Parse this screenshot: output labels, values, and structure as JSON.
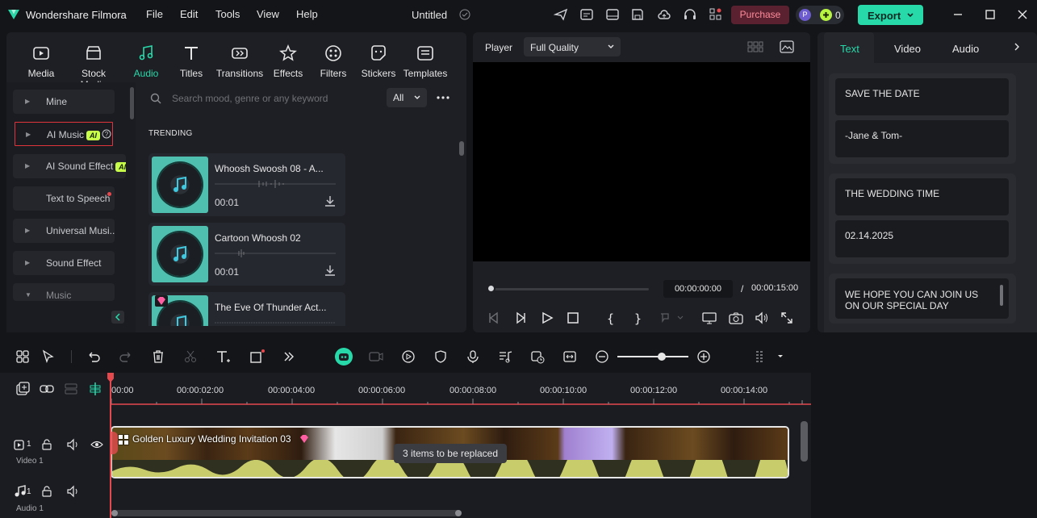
{
  "app": {
    "name": "Wondershare Filmora",
    "project_title": "Untitled"
  },
  "menu": [
    "File",
    "Edit",
    "Tools",
    "View",
    "Help"
  ],
  "topbar": {
    "purchase_label": "Purchase",
    "credits": "0",
    "avatar_letter": "P",
    "export_label": "Export"
  },
  "toolbar": [
    {
      "label": "Media",
      "icon": "media-icon"
    },
    {
      "label": "Stock Media",
      "icon": "stock-media-icon"
    },
    {
      "label": "Audio",
      "icon": "audio-icon",
      "active": true
    },
    {
      "label": "Titles",
      "icon": "titles-icon"
    },
    {
      "label": "Transitions",
      "icon": "transitions-icon"
    },
    {
      "label": "Effects",
      "icon": "effects-icon"
    },
    {
      "label": "Filters",
      "icon": "filters-icon"
    },
    {
      "label": "Stickers",
      "icon": "stickers-icon"
    },
    {
      "label": "Templates",
      "icon": "templates-icon"
    }
  ],
  "sidebar": {
    "items": [
      {
        "label": "Mine"
      },
      {
        "label": "AI Music",
        "badge": "AI"
      },
      {
        "label": "AI Sound Effect",
        "badge": "AI"
      },
      {
        "label": "Text to Speech"
      },
      {
        "label": "Universal Musi..."
      },
      {
        "label": "Sound Effect"
      },
      {
        "label": "Music"
      }
    ]
  },
  "search": {
    "placeholder": "Search mood, genre or any keyword",
    "filter": "All"
  },
  "section_label": "TRENDING",
  "audio_items": [
    {
      "title": "Whoosh Swoosh 08 - A...",
      "duration": "00:01"
    },
    {
      "title": "Cartoon Whoosh 02",
      "duration": "00:01"
    },
    {
      "title": "The Eve Of Thunder Act...",
      "duration": ""
    }
  ],
  "player": {
    "label": "Player",
    "quality": "Full Quality",
    "current_time": "00:00:00:00",
    "separator": "/",
    "total_time": "00:00:15:00",
    "progress": 0
  },
  "props": {
    "tabs": [
      "Text",
      "Video",
      "Audio"
    ],
    "active_tab": "Text",
    "groups": [
      [
        "SAVE THE DATE",
        "-Jane & Tom-"
      ],
      [
        "THE WEDDING TIME",
        "02.14.2025"
      ],
      [
        "WE HOPE YOU CAN JOIN US ON OUR SPECIAL DAY"
      ]
    ]
  },
  "timeline": {
    "ruler": [
      "00:00",
      "00:00:02:00",
      "00:00:04:00",
      "00:00:06:00",
      "00:00:08:00",
      "00:00:10:00",
      "00:00:12:00",
      "00:00:14:00"
    ],
    "clip_title": "Golden Luxury Wedding Invitation 03",
    "replace_tooltip": "3 items to be replaced",
    "tracks": [
      {
        "number": "1",
        "label": "Video 1"
      },
      {
        "number": "1",
        "label": "Audio 1"
      }
    ]
  },
  "colors": {
    "accent": "#27d9a9",
    "purchase": "#ff8a9a",
    "playhead": "#e5484d",
    "waveform": "#c9cc6a"
  }
}
